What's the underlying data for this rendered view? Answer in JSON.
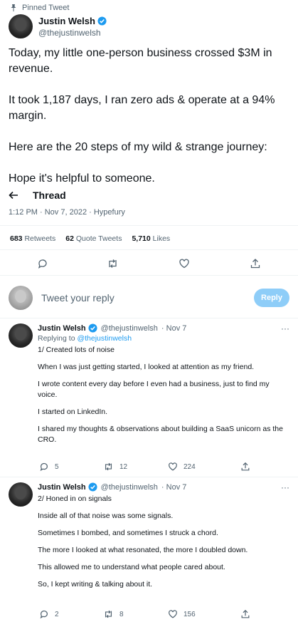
{
  "pinned_label": "Pinned Tweet",
  "author": {
    "name": "Justin Welsh",
    "handle": "@thejustinwelsh"
  },
  "main_tweet": {
    "paragraphs": [
      "Today, my little one-person business crossed $3M in revenue.",
      "It took 1,187 days, I ran zero ads & operate at a 94% margin.",
      "Here are the 20 steps of my wild & strange journey:",
      "Hope it's helpful to someone."
    ],
    "thread_label": "Thread",
    "meta": "1:12 PM · Nov 7, 2022 · Hypefury"
  },
  "stats": {
    "retweets_count": "683",
    "retweets_label": "Retweets",
    "quotes_count": "62",
    "quotes_label": "Quote Tweets",
    "likes_count": "5,710",
    "likes_label": "Likes"
  },
  "reply_composer": {
    "placeholder": "Tweet your reply",
    "button": "Reply"
  },
  "replies": [
    {
      "name": "Justin Welsh",
      "handle": "@thejustinwelsh",
      "date": "· Nov 7",
      "replying_to_label": "Replying to",
      "replying_to_handle": "@thejustinwelsh",
      "lines": [
        "1/ Created lots of noise",
        "When I was just getting started, I looked at attention as my friend.",
        "I wrote content every day before I even had a business, just to find my voice.",
        "I started on LinkedIn.",
        "I shared my thoughts & observations about building a SaaS unicorn as the CRO."
      ],
      "replies_count": "5",
      "retweets_count": "12",
      "likes_count": "224"
    },
    {
      "name": "Justin Welsh",
      "handle": "@thejustinwelsh",
      "date": "· Nov 7",
      "lines": [
        "2/ Honed in on signals",
        "Inside all of that noise was some signals.",
        "Sometimes I bombed, and sometimes I struck a chord.",
        "The more I looked at what resonated, the more I doubled down.",
        "This allowed me to understand what people cared about.",
        "So, I kept writing & talking about it."
      ],
      "replies_count": "2",
      "retweets_count": "8",
      "likes_count": "156"
    }
  ],
  "colors": {
    "accent": "#1d9bf0",
    "muted": "#536471",
    "reply_button": "#8ecdf8",
    "like": "#536471"
  },
  "icons": [
    "pin-icon",
    "verified-icon",
    "back-arrow-icon",
    "reply-icon",
    "retweet-icon",
    "like-icon",
    "share-icon",
    "more-icon"
  ]
}
